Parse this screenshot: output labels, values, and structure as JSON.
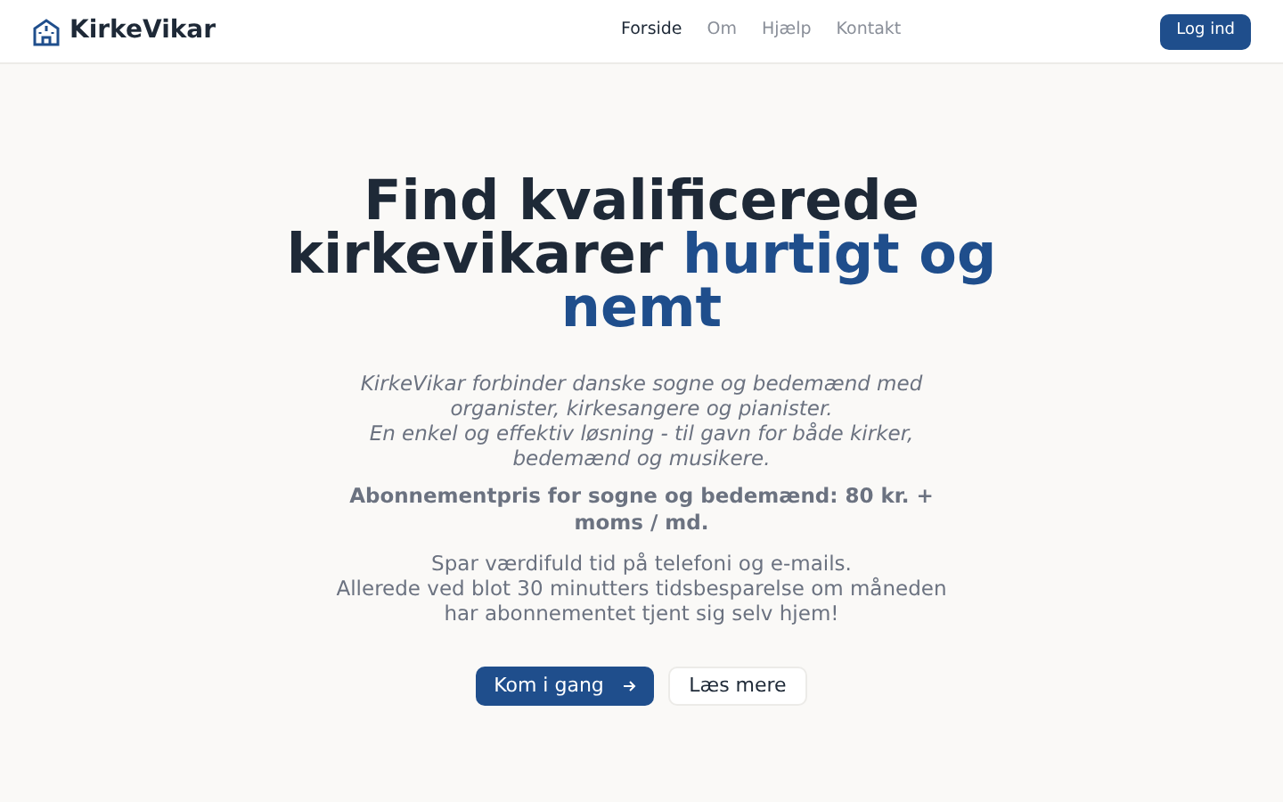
{
  "header": {
    "brand": "KirkeVikar",
    "nav": [
      {
        "label": "Forside",
        "selected": true
      },
      {
        "label": "Om",
        "selected": false
      },
      {
        "label": "Hjælp",
        "selected": false
      },
      {
        "label": "Kontakt",
        "selected": false
      }
    ],
    "login": "Log ind"
  },
  "hero": {
    "heading": "Find kvalificerede kirkevikarer",
    "highlight": "hurtigt og nemt",
    "intro": [
      "KirkeVikar forbinder danske sogne og bedemænd med organister, kirkesangere og pianister.",
      "En enkel og effektiv løsning - til gavn for både kirker, bedemænd og musikere."
    ],
    "price": "Abonnementpris for sogne og bedemænd: 80 kr. + moms / md.",
    "savings": [
      "Spar værdifuld tid på telefoni og e-mails.",
      "Allerede ved blot 30 minutters tidsbesparelse om måneden har abonnementet tjent sig selv hjem!"
    ],
    "primary_button": "Kom i gang",
    "secondary_button": "Læs mere"
  }
}
